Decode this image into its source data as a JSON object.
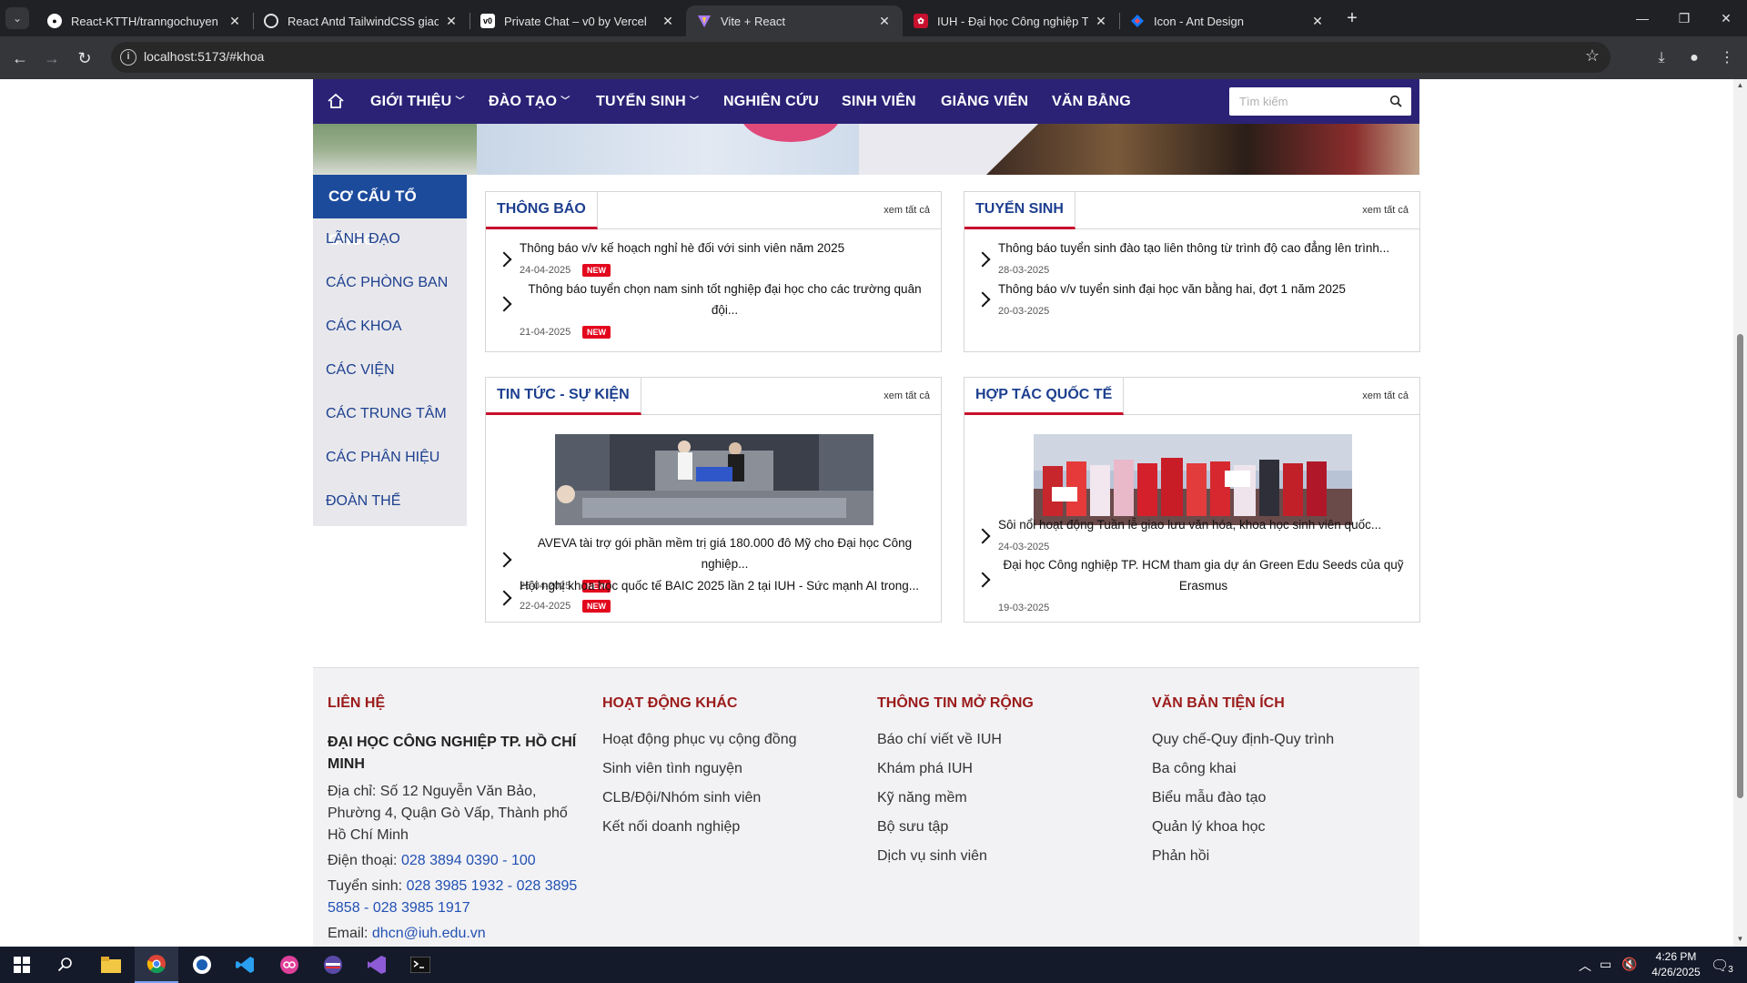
{
  "browser": {
    "tabs": [
      {
        "title": "React-KTTH/tranngochuyen at",
        "favicon": "github-icon"
      },
      {
        "title": "React Antd TailwindCSS giao di",
        "favicon": "openai-icon"
      },
      {
        "title": "Private Chat – v0 by Vercel",
        "favicon": "v0-icon"
      },
      {
        "title": "Vite + React",
        "favicon": "vite-icon",
        "active": true
      },
      {
        "title": "IUH - Đại học Công nghiệp TP.I",
        "favicon": "iuh-icon"
      },
      {
        "title": "Icon - Ant Design",
        "favicon": "antd-icon"
      }
    ],
    "url": "localhost:5173/#khoa"
  },
  "site": {
    "nav": {
      "items": [
        {
          "label": "GIỚI THIỆU",
          "has_caret": true
        },
        {
          "label": "ĐÀO TẠO",
          "has_caret": true
        },
        {
          "label": "TUYỂN SINH",
          "has_caret": true
        },
        {
          "label": "NGHIÊN CỨU",
          "has_caret": false
        },
        {
          "label": "SINH VIÊN",
          "has_caret": false
        },
        {
          "label": "GIẢNG VIÊN",
          "has_caret": false
        },
        {
          "label": "VĂN BẰNG",
          "has_caret": false
        }
      ],
      "search_placeholder": "Tìm kiếm",
      "accent": "#2b2276"
    },
    "sidebar": {
      "heading": "CƠ CẤU TỔ CHỨC",
      "items": [
        "LÃNH ĐẠO",
        "CÁC PHÒNG BAN",
        "CÁC KHOA",
        "CÁC VIỆN",
        "CÁC TRUNG TÂM",
        "CÁC PHÂN HIỆU",
        "ĐOÀN THỂ"
      ]
    },
    "see_all": "xem tất cả",
    "new_badge": "NEW",
    "cards": {
      "thong_bao": {
        "title": "THÔNG BÁO",
        "items": [
          {
            "title": "Thông báo v/v kế hoạch nghỉ hè đối với sinh viên năm 2025",
            "date": "24-04-2025"
          },
          {
            "title": "Thông báo tuyển chọn nam sinh tốt nghiệp đại học cho các trường quân đội...",
            "date": "21-04-2025"
          }
        ]
      },
      "tuyen_sinh": {
        "title": "TUYỂN SINH",
        "items": [
          {
            "title": "Thông báo tuyển sinh đào tạo liên thông từ trình độ cao đẳng lên trình...",
            "date": "28-03-2025"
          },
          {
            "title": "Thông báo v/v tuyển sinh đại học văn bằng hai, đợt 1 năm 2025",
            "date": "20-03-2025"
          }
        ]
      },
      "tin_tuc": {
        "title": "TIN TỨC - SỰ KIỆN",
        "items": [
          {
            "title": "AVEVA tài trợ gói phần mềm trị giá 180.000 đô Mỹ cho Đại học Công nghiệp...",
            "date": "25-04-2025"
          },
          {
            "title": "Hội nghị khoa học quốc tế BAIC 2025 lần 2 tại IUH - Sức mạnh AI trong...",
            "date": "22-04-2025"
          }
        ]
      },
      "hop_tac": {
        "title": "HỢP TÁC QUỐC TẾ",
        "items": [
          {
            "title": "Sôi nổi hoạt động Tuần lễ giao lưu văn hóa, khoa học sinh viên quốc...",
            "date": "24-03-2025"
          },
          {
            "title": "Đại học Công nghiệp TP. HCM tham gia dự án Green Edu Seeds của quỹ Erasmus",
            "date": "19-03-2025"
          }
        ]
      }
    },
    "footer": {
      "contact": {
        "heading": "LIÊN HỆ",
        "org": "ĐẠI HỌC CÔNG NGHIỆP TP. HỒ CHÍ MINH",
        "address": "Địa chỉ: Số 12 Nguyễn Văn Bảo, Phường 4, Quận Gò Vấp, Thành phố Hồ Chí Minh",
        "phone_label": "Điện thoại:",
        "phone_value": "028 3894 0390 - 100",
        "admission_label": "Tuyển sinh:",
        "admission_value": "028 3985 1932 - 028 3895 5858 - 028 3985 1917",
        "email_label": "Email:",
        "email_value": "dhcn@iuh.edu.vn"
      },
      "other": {
        "heading": "HOẠT ĐỘNG KHÁC",
        "links": [
          "Hoạt động phục vụ cộng đồng",
          "Sinh viên tình nguyện",
          "CLB/Đội/Nhóm sinh viên",
          "Kết nối doanh nghiệp"
        ]
      },
      "more": {
        "heading": "THÔNG TIN MỞ RỘNG",
        "links": [
          "Báo chí viết về IUH",
          "Khám phá IUH",
          "Kỹ năng mềm",
          "Bộ sưu tập",
          "Dịch vụ sinh viên"
        ]
      },
      "docs": {
        "heading": "VĂN BẢN TIỆN ÍCH",
        "links": [
          "Quy chế-Quy định-Quy trình",
          "Ba công khai",
          "Biểu mẫu đào tạo",
          "Quản lý khoa học",
          "Phản hồi"
        ]
      }
    }
  },
  "taskbar": {
    "time": "4:26 PM",
    "date": "4/26/2025",
    "notification_count": "3"
  }
}
